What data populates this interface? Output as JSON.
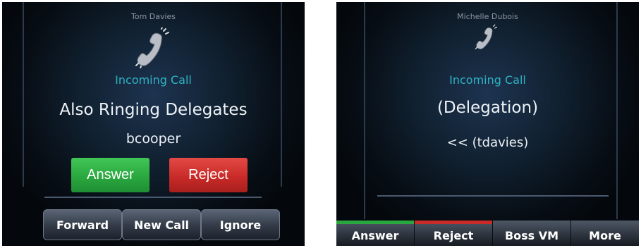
{
  "left_screen": {
    "caller_name": "Tom Davies",
    "handset_icon": "ringing-handset",
    "status": "Incoming Call",
    "line1": "Also Ringing Delegates",
    "line2": "bcooper",
    "answer_label": "Answer",
    "reject_label": "Reject",
    "softkeys": [
      "Forward",
      "New Call",
      "Ignore"
    ]
  },
  "right_screen": {
    "caller_name": "Michelle Dubois",
    "handset_icon": "ringing-handset",
    "status": "Incoming Call",
    "line1": "(Delegation)",
    "line2": "<< (tdavies)",
    "softkeys": [
      {
        "label": "Answer",
        "accent": "#2aa83f"
      },
      {
        "label": "Reject",
        "accent": "#c92b28"
      },
      {
        "label": "Boss VM",
        "accent": ""
      },
      {
        "label": "More",
        "accent": ""
      }
    ]
  },
  "colors": {
    "status_text": "#2fb3c4",
    "answer_green": "#2aa83f",
    "reject_red": "#c92b28"
  }
}
